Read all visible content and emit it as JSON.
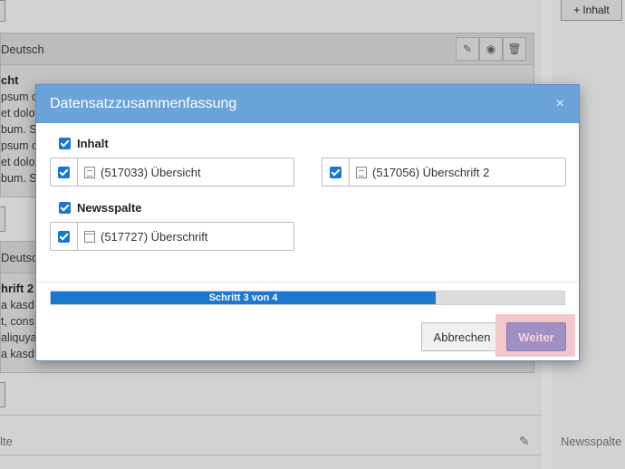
{
  "background": {
    "top_right_button": "Inhalt",
    "cards": [
      {
        "header": "Deutsch",
        "title": "cht",
        "lines": [
          "psum o",
          "et dolor",
          "bum. S",
          "psum o",
          "et dolor",
          "bum. S"
        ]
      },
      {
        "header": "Deutsc",
        "title": "hrift 2",
        "lines": [
          "a kasd",
          "t, cons",
          "aliquya",
          "a kasd"
        ]
      }
    ],
    "footer_left_label": "lte",
    "footer_right_label": "Newsspalte"
  },
  "modal": {
    "title": "Datensatzzusammenfassung",
    "close_glyph": "×",
    "groups": [
      {
        "label": "Inhalt",
        "records": [
          {
            "label": "(517033) Übersicht",
            "icon": "text-content-icon"
          },
          {
            "label": "(517056) Überschrift 2",
            "icon": "text-content-icon"
          }
        ]
      },
      {
        "label": "Newsspalte",
        "records": [
          {
            "label": "(517727) Überschrift",
            "icon": "header-content-icon"
          }
        ]
      }
    ],
    "progress": {
      "text": "Schritt 3 von 4",
      "fraction": 0.75
    },
    "buttons": {
      "cancel": "Abbrechen",
      "next": "Weiter"
    }
  },
  "colors": {
    "modal_header": "#6aa3da",
    "checkbox": "#1976d2",
    "progress_fill": "#1b77d2",
    "next_button": "#a08fc2",
    "next_highlight": "#f3c8cd"
  }
}
